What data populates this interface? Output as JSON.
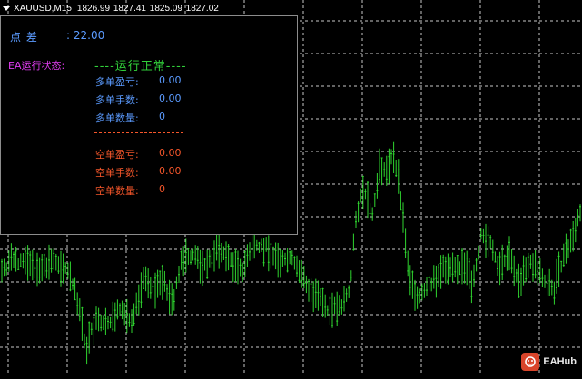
{
  "chart": {
    "symbol": "XAUUSD,M15",
    "ohlc": "1826.99 1827.41 1825.09 1827.02",
    "grid_color": "#c8c8c8",
    "bar_color": "#2fd52f",
    "background": "#000000"
  },
  "panel": {
    "spread_label": "点    差",
    "spread_value": ": 22.00",
    "ea_status_label": "EA运行状态:",
    "ea_status_value": "----运行正常----",
    "divider": "------------------------------",
    "long": {
      "profit_label": "多单盈亏:",
      "profit_value": "0.00",
      "lots_label": "多单手数:",
      "lots_value": "0.00",
      "count_label": "多单数量:",
      "count_value": "0"
    },
    "short": {
      "profit_label": "空单盈亏:",
      "profit_value": "0.00",
      "lots_label": "空单手数:",
      "lots_value": "0.00",
      "count_label": "空单数量:",
      "count_value": "0"
    },
    "colors": {
      "long": "#5b9bff",
      "short": "#f5562a",
      "status_label": "#e03cf0",
      "status_value": "#31d03a",
      "border": "#8c8c8c"
    }
  },
  "watermark": {
    "text": "EAHub",
    "icon": "eahub-logo-icon"
  }
}
